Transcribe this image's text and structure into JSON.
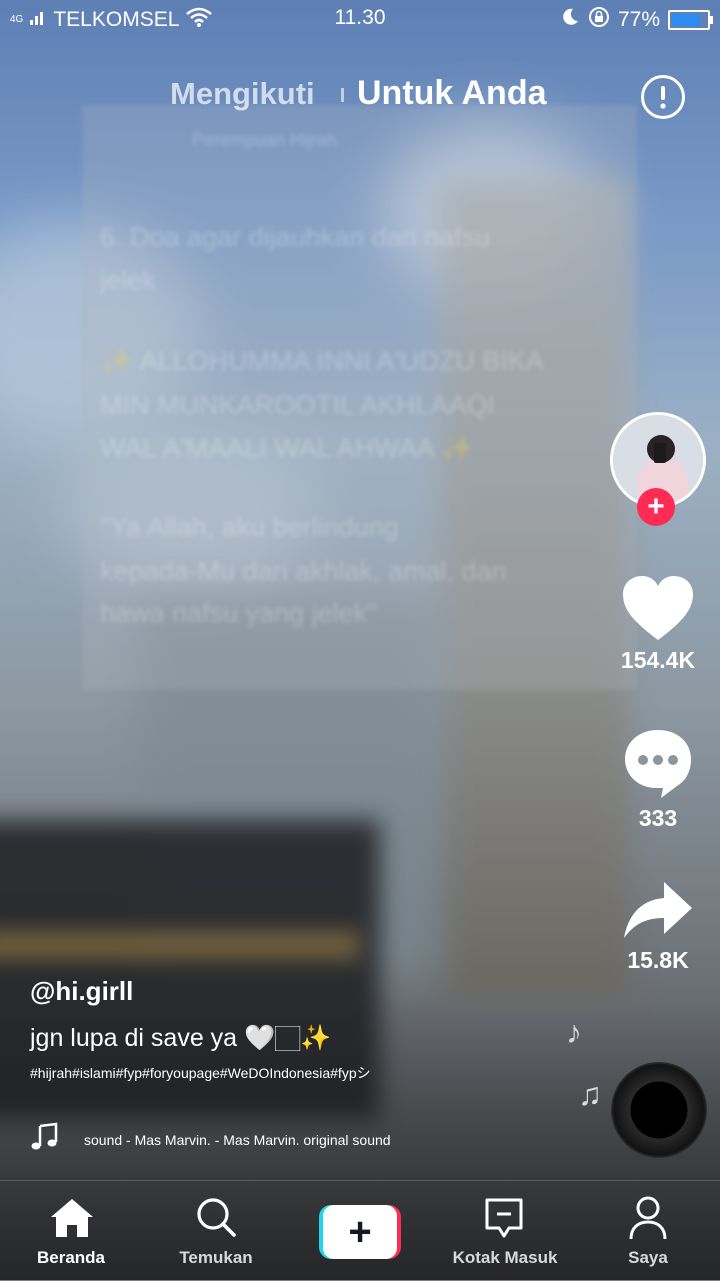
{
  "status_bar": {
    "network": "4G",
    "carrier": "TELKOMSEL",
    "time": "11.30",
    "battery_percent": "77%",
    "icons": [
      "signal-icon",
      "wifi-icon",
      "moon-icon",
      "rotation-lock-icon",
      "battery-icon"
    ]
  },
  "top_nav": {
    "following": "Mengikuti",
    "for_you": "Untuk Anda",
    "report_icon": "exclamation-circle-icon"
  },
  "video": {
    "username": "@hi.girll",
    "caption": "jgn lupa di save ya 🤍🏻✨",
    "hashtags": "#hijrah#islami#fyp#foryoupage#WeDOIndonesia#fypシ",
    "music": "sound - Mas Marvin. - Mas Marvin.    original sound",
    "background_text": [
      "Perempuan Hijrah",
      "6. Doa agar dijauhkan dari nafsu",
      "jelek",
      "✨ ALLOHUMMA INNI A'UDZU BIKA",
      "MIN MUNKAROOTIL AKHLAAQI",
      "WAL A'MAALI WAL AHWAA ✨",
      "\"Ya Allah, aku berlindung",
      "kepada-Mu dari akhlak, amal, dan",
      "hawa nafsu yang jelek\""
    ]
  },
  "actions": {
    "likes": "154.4K",
    "comments": "333",
    "shares": "15.8K",
    "follow_icon": "plus-icon",
    "like_icon": "heart-icon",
    "comment_icon": "chat-bubble-icon",
    "share_icon": "share-arrow-icon"
  },
  "bottom_nav": {
    "home": "Beranda",
    "discover": "Temukan",
    "create_icon": "plus-icon",
    "inbox": "Kotak Masuk",
    "profile": "Saya"
  },
  "colors": {
    "accent_red": "#fe2c55",
    "accent_cyan": "#20d5ec",
    "battery_blue": "#2d8cf0"
  }
}
